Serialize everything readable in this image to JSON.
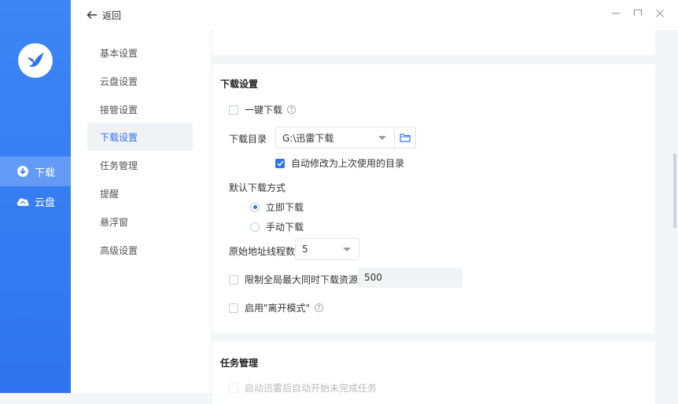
{
  "nav": {
    "items": [
      {
        "label": "下载",
        "icon": "download-icon"
      },
      {
        "label": "云盘",
        "icon": "cloud-icon"
      }
    ]
  },
  "topbar": {
    "back_label": "返回"
  },
  "settings_menu": {
    "items": [
      "基本设置",
      "云盘设置",
      "接管设置",
      "下载设置",
      "任务管理",
      "提醒",
      "悬浮窗",
      "高级设置"
    ],
    "active": "下载设置"
  },
  "download": {
    "title": "下载设置",
    "one_click_label": "一键下载",
    "dir_label": "下载目录",
    "dir_value": "G:\\迅雷下载",
    "auto_modify_label": "自动修改为上次使用的目录",
    "default_method_label": "默认下载方式",
    "method_options": [
      "立即下载",
      "手动下载"
    ],
    "method_selected": "立即下载",
    "threads_label": "原始地址线程数",
    "threads_value": "5",
    "limit_label": "限制全局最大同时下载资源数",
    "limit_value": "500",
    "leave_mode_label": "启用\"离开模式\""
  },
  "task": {
    "title": "任务管理",
    "auto_start_label": "启动迅雷后自动开始未完成任务"
  },
  "colors": {
    "accent": "#2f74ee",
    "sidebar": "#3d86f5"
  }
}
